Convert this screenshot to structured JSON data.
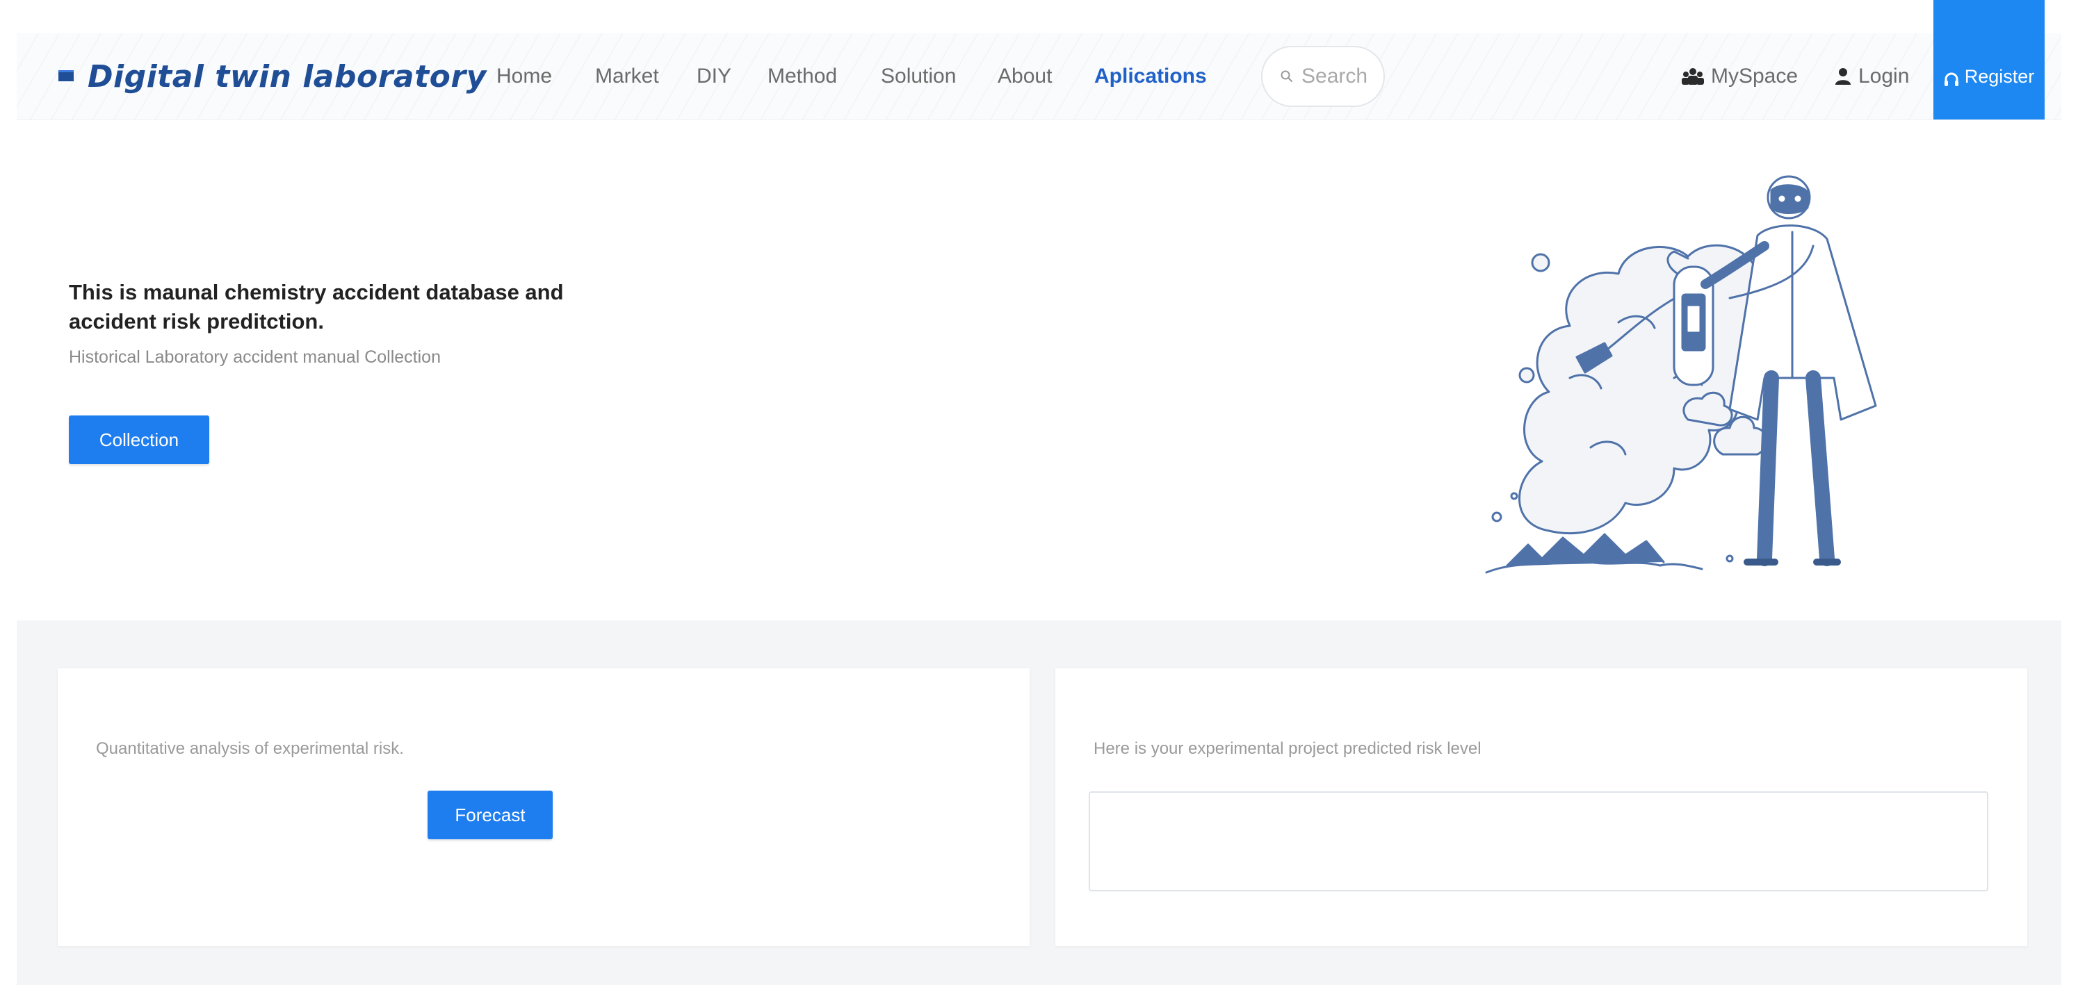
{
  "brand": {
    "title": "Digital twin laboratory"
  },
  "nav": {
    "items": [
      {
        "label": "Home"
      },
      {
        "label": "Market"
      },
      {
        "label": "DIY"
      },
      {
        "label": "Method"
      },
      {
        "label": "Solution"
      },
      {
        "label": "About"
      },
      {
        "label": "Aplications",
        "active": true
      }
    ],
    "search_placeholder": "Search",
    "myspace_label": "MySpace",
    "login_label": "Login",
    "register_label": "Register"
  },
  "hero": {
    "title": "This is maunal chemistry accident database and accident risk preditction.",
    "subtitle": "Historical Laboratory accident manual Collection",
    "collection_label": "Collection"
  },
  "cards": {
    "left": {
      "text": "Quantitative analysis of experimental risk.",
      "forecast_label": "Forecast"
    },
    "right": {
      "text": "Here is your experimental project predicted risk level",
      "result_value": ""
    }
  },
  "colors": {
    "brand": "#1f4e96",
    "accent": "#1e7ef0",
    "register_bg": "#1e88f2",
    "illustration": "#4f72a9"
  },
  "icons": {
    "brand": "book-icon",
    "search": "search-icon",
    "myspace": "users-icon",
    "login": "user-icon",
    "register": "headset-icon"
  }
}
